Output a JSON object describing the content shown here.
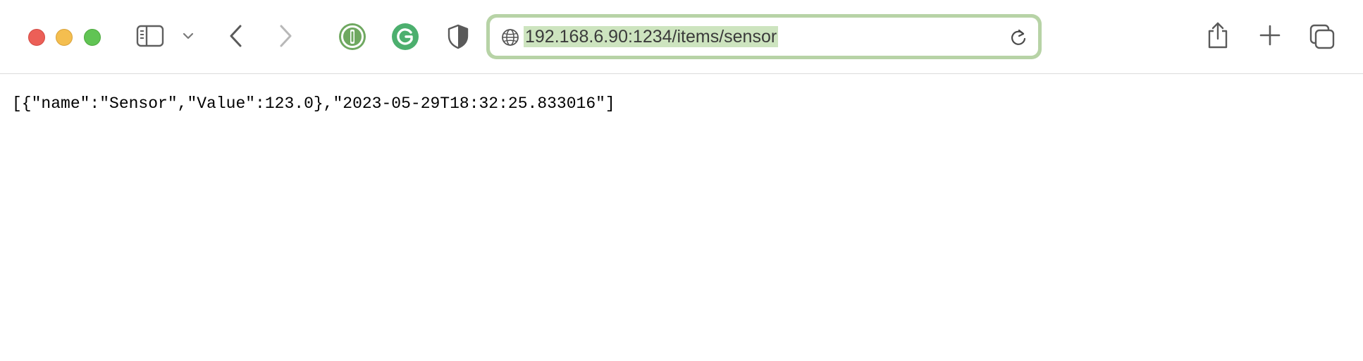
{
  "browser": {
    "address_bar": {
      "url": "192.168.6.90:1234/items/sensor"
    },
    "toolbar": {
      "icons": [
        "sidebar-icon",
        "chevron-down-icon",
        "back-icon",
        "forward-icon",
        "onepassword-icon",
        "grammarly-icon",
        "shield-icon",
        "globe-icon",
        "reload-icon",
        "share-icon",
        "plus-icon",
        "tabs-overview-icon"
      ]
    },
    "colors": {
      "address_focus_ring": "#b7d3a6",
      "url_selection": "#cde4bf",
      "onepassword": "#6fa860",
      "grammarly": "#15c39a"
    }
  },
  "page": {
    "body_text": "[{\"name\":\"Sensor\",\"Value\":123.0},\"2023-05-29T18:32:25.833016\"]"
  }
}
